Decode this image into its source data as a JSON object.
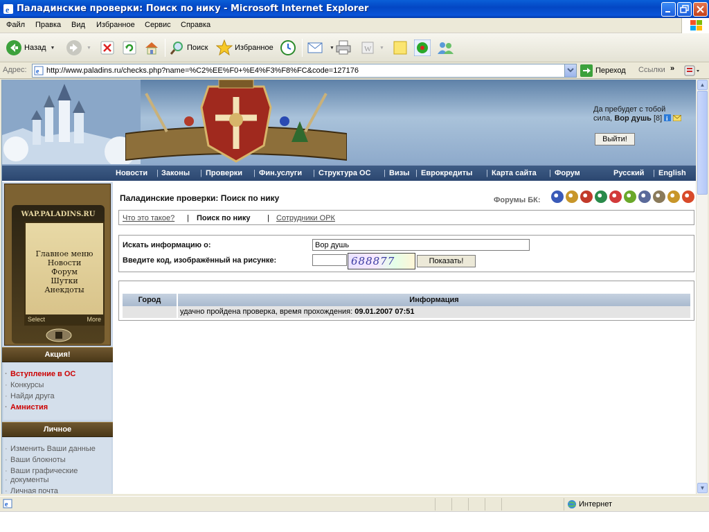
{
  "window": {
    "title": "Паладинские проверки: Поиск по нику - Microsoft Internet Explorer"
  },
  "menu": [
    "Файл",
    "Правка",
    "Вид",
    "Избранное",
    "Сервис",
    "Справка"
  ],
  "toolbar": {
    "back": "Назад",
    "search": "Поиск",
    "favorites": "Избранное"
  },
  "address": {
    "label": "Адрес:",
    "url": "http://www.paladins.ru/checks.php?name=%C2%EE%F0+%E4%F3%F8%FC&code=127176",
    "go": "Переход",
    "links": "Ссылки"
  },
  "site": {
    "greeting_line1": "Да пребудет с тобой",
    "greeting_line2": "сила,",
    "user": "Вор душь",
    "level": "[8]",
    "logout": "Выйти!",
    "nav": [
      "Новости",
      "Законы",
      "Проверки",
      "Фин.услуги",
      "Структура ОС",
      "Визы",
      "Еврокредиты",
      "Карта сайта",
      "Форум"
    ],
    "lang": [
      "Русский",
      "English"
    ]
  },
  "sidebar": {
    "wap": {
      "title": "WAP.PALADINS.RU",
      "items": [
        "Главное меню",
        "Новости",
        "Форум",
        "Шутки",
        "Анекдоты"
      ],
      "select": "Select",
      "more": "More"
    },
    "promo": {
      "title": "Акция!",
      "items": [
        {
          "label": "Вступление в ОС",
          "highlight": true
        },
        {
          "label": "Конкурсы",
          "highlight": false
        },
        {
          "label": "Найди друга",
          "highlight": false
        },
        {
          "label": "Амнистия",
          "highlight": true
        }
      ]
    },
    "personal": {
      "title": "Личное",
      "items": [
        "Изменить Ваши данные",
        "Ваши блокноты",
        "Ваши графические",
        "документы",
        "Личная почта"
      ]
    }
  },
  "main": {
    "heading": "Паладинские проверки: Поиск по нику",
    "forums_label": "Форумы БК:",
    "tabs": [
      "Что это такое?",
      "Поиск по нику",
      "Сотрудники ОРК"
    ],
    "separator": "|",
    "form": {
      "search_label": "Искать информацию о:",
      "nick_value": "Вор душь",
      "code_label": "Введите код, изображённый на рисунке:",
      "code_value": "",
      "captcha": "688877",
      "submit": "Показать!"
    },
    "results": {
      "headers": [
        "Город",
        "Информация"
      ],
      "row": {
        "city": "",
        "text": "удачно пройдена проверка, время прохождения:",
        "time": "09.01.2007 07:51"
      }
    }
  },
  "status": {
    "zone": "Интернет"
  },
  "colors": {
    "nav_bg": "#2b4670",
    "sidebar_header": "#4a3818",
    "highlight_link": "#cc0000",
    "table_header": "#b7c6d8"
  }
}
